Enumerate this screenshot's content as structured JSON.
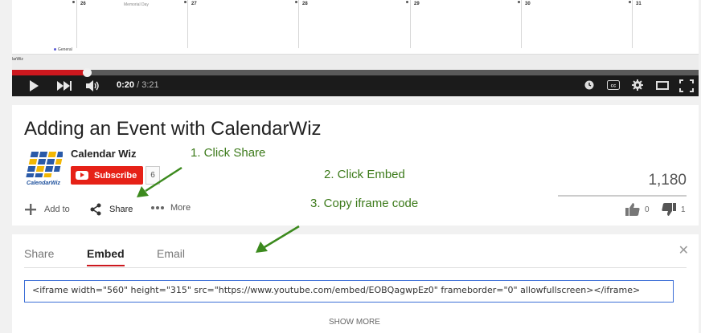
{
  "calendar": {
    "days": [
      "26",
      "27",
      "28",
      "29",
      "30",
      "31"
    ],
    "holiday": "Memorial Day",
    "legend": "General",
    "app_label": "larWiz"
  },
  "player": {
    "current_time": "0:20",
    "duration": "/ 3:21",
    "progress": 0.109
  },
  "video": {
    "title": "Adding an Event with CalendarWiz",
    "channel_name": "Calendar Wiz",
    "channel_logo_text": "CalendarWiz",
    "subscribe_label": "Subscribe",
    "subscriber_count": "6",
    "views": "1,180",
    "actions": {
      "add_to": "Add to",
      "share": "Share",
      "more": "More"
    },
    "likes": "0",
    "dislikes": "1"
  },
  "share_panel": {
    "tabs": [
      "Share",
      "Embed",
      "Email"
    ],
    "active_tab": "Embed",
    "embed_code": "<iframe width=\"560\" height=\"315\" src=\"https://www.youtube.com/embed/EOBQagwpEz0\" frameborder=\"0\" allowfullscreen></iframe>",
    "show_more": "SHOW MORE"
  },
  "annotations": {
    "step1": "1. Click Share",
    "step2": "2. Click Embed",
    "step3": "3. Copy iframe code",
    "color": "#3c7a1a"
  },
  "colors": {
    "accent_red": "#cc181e",
    "subscribe_red": "#e62117",
    "input_border": "#3b6ed6"
  }
}
